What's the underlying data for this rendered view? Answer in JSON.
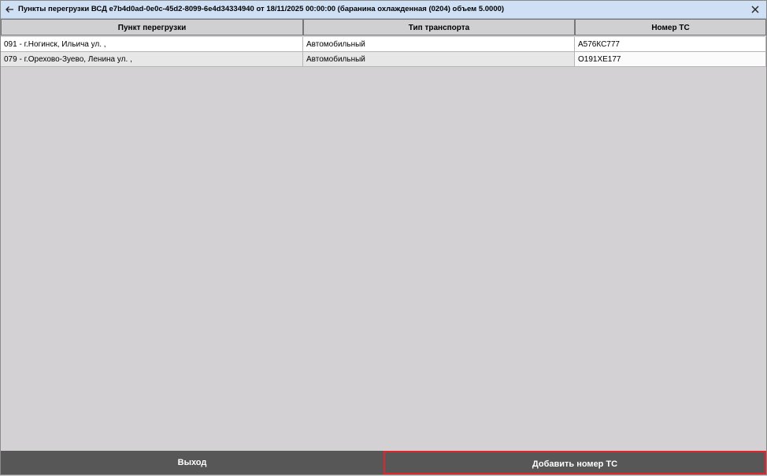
{
  "window": {
    "title": "Пункты перегрузки ВСД e7b4d0ad-0e0c-45d2-8099-6e4d34334940 от 18/11/2025 00:00:00 (баранина охлажденная (0204) объем 5.0000)"
  },
  "table": {
    "columns": [
      "Пункт перегрузки",
      "Тип транспорта",
      "Номер ТС"
    ],
    "rows": [
      [
        "091 - г.Ногинск, Ильича ул. ,",
        "Автомобильный",
        "А576КС777"
      ],
      [
        "079 - г.Орехово-Зуево, Ленина ул. ,",
        "Автомобильный",
        "О191ХЕ177"
      ]
    ]
  },
  "footer": {
    "exit_label": "Выход",
    "add_label": "Добавить номер ТС"
  },
  "colors": {
    "titlebar": "#cfe0f4",
    "footer": "#575757",
    "highlight": "#e0262b"
  },
  "icons": {
    "back": "arrow-left-icon",
    "close": "close-icon"
  }
}
